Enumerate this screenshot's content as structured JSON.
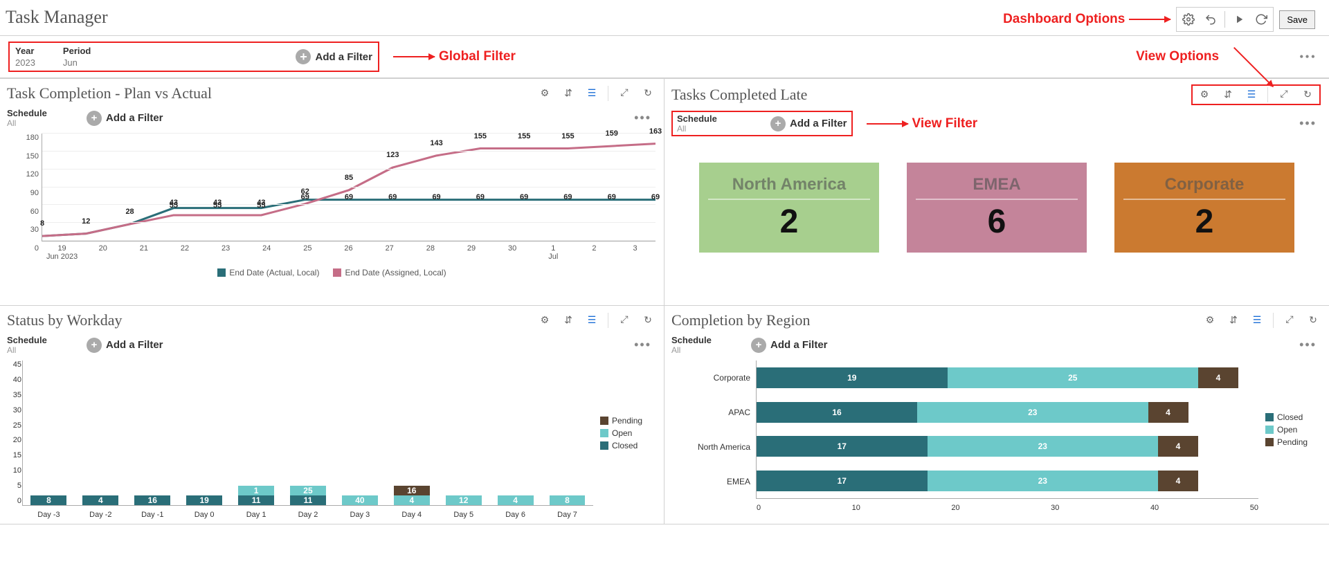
{
  "title": "Task Manager",
  "annotations": {
    "dashboard_options": "Dashboard Options",
    "global_filter": "Global Filter",
    "view_options": "View Options",
    "view_filter": "View Filter"
  },
  "toolbar": {
    "save": "Save"
  },
  "global_filter": {
    "year_label": "Year",
    "year_value": "2023",
    "period_label": "Period",
    "period_value": "Jun",
    "add_filter": "Add a Filter"
  },
  "panels": {
    "plan_vs_actual": {
      "title": "Task Completion - Plan vs Actual",
      "schedule_label": "Schedule",
      "schedule_value": "All",
      "add_filter": "Add a Filter",
      "legend_actual": "End Date (Actual, Local)",
      "legend_assigned": "End Date (Assigned, Local)",
      "period_start": "Jun 2023",
      "period_jul": "Jul"
    },
    "late": {
      "title": "Tasks Completed Late",
      "schedule_label": "Schedule",
      "schedule_value": "All",
      "add_filter": "Add a Filter",
      "cards": [
        {
          "name": "North America",
          "value": "2",
          "class": "na"
        },
        {
          "name": "EMEA",
          "value": "6",
          "class": "emea"
        },
        {
          "name": "Corporate",
          "value": "2",
          "class": "corp"
        }
      ]
    },
    "status_workday": {
      "title": "Status by Workday",
      "schedule_label": "Schedule",
      "schedule_value": "All",
      "add_filter": "Add a Filter",
      "legend": [
        "Pending",
        "Open",
        "Closed"
      ]
    },
    "completion_region": {
      "title": "Completion by Region",
      "schedule_label": "Schedule",
      "schedule_value": "All",
      "add_filter": "Add a Filter",
      "legend": [
        "Closed",
        "Open",
        "Pending"
      ]
    }
  },
  "chart_data": [
    {
      "id": "plan_vs_actual",
      "type": "line",
      "x": [
        "19",
        "20",
        "21",
        "22",
        "23",
        "24",
        "25",
        "26",
        "27",
        "28",
        "29",
        "30",
        "1",
        "2",
        "3"
      ],
      "series": [
        {
          "name": "End Date (Actual, Local)",
          "color": "#2a6e78",
          "values": [
            8,
            12,
            28,
            55,
            55,
            55,
            69,
            69,
            69,
            69,
            69,
            69,
            69,
            69,
            69
          ]
        },
        {
          "name": "End Date (Assigned, Local)",
          "color": "#c56d87",
          "values": [
            8,
            12,
            28,
            43,
            43,
            43,
            62,
            85,
            123,
            143,
            155,
            155,
            155,
            159,
            163
          ]
        }
      ],
      "ylim": [
        0,
        180
      ],
      "yticks": [
        0,
        30,
        60,
        90,
        120,
        150,
        180
      ]
    },
    {
      "id": "status_workday",
      "type": "bar",
      "categories": [
        "Day -3",
        "Day -2",
        "Day -1",
        "Day 0",
        "Day 1",
        "Day 2",
        "Day 3",
        "Day 4",
        "Day 5",
        "Day 6",
        "Day 7"
      ],
      "series": [
        {
          "name": "Closed",
          "color": "#2a6e78",
          "values": [
            8,
            4,
            16,
            19,
            11,
            11,
            0,
            0,
            0,
            0,
            0
          ]
        },
        {
          "name": "Open",
          "color": "#6dc9c9",
          "values": [
            0,
            0,
            0,
            0,
            1,
            25,
            40,
            4,
            12,
            4,
            8
          ]
        },
        {
          "name": "Pending",
          "color": "#5a4430",
          "values": [
            0,
            0,
            0,
            0,
            0,
            0,
            0,
            16,
            0,
            0,
            0
          ]
        }
      ],
      "ylim": [
        0,
        45
      ],
      "yticks": [
        0,
        5,
        10,
        15,
        20,
        25,
        30,
        35,
        40,
        45
      ]
    },
    {
      "id": "completion_region",
      "type": "bar",
      "orientation": "horizontal",
      "categories": [
        "Corporate",
        "APAC",
        "North America",
        "EMEA"
      ],
      "series": [
        {
          "name": "Closed",
          "color": "#2a6e78",
          "values": [
            19,
            16,
            17,
            17
          ]
        },
        {
          "name": "Open",
          "color": "#6dc9c9",
          "values": [
            25,
            23,
            23,
            23
          ]
        },
        {
          "name": "Pending",
          "color": "#5a4430",
          "values": [
            4,
            4,
            4,
            4
          ]
        }
      ],
      "xlim": [
        0,
        50
      ],
      "xticks": [
        0,
        10,
        20,
        30,
        40,
        50
      ]
    }
  ]
}
